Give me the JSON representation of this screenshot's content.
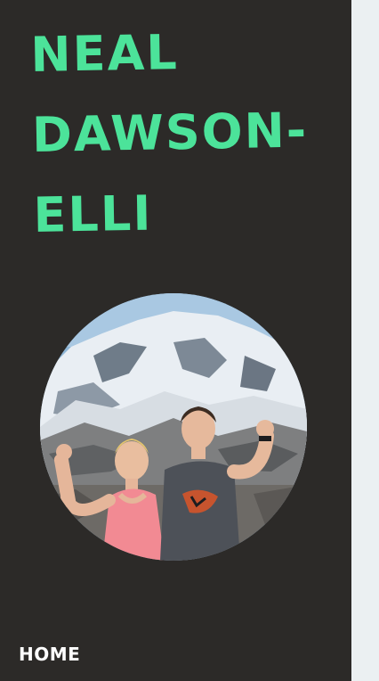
{
  "site": {
    "title_lines": [
      "NEAL",
      "DAWSON-",
      "ELLI"
    ]
  },
  "avatar": {
    "description": "circular profile photo"
  },
  "nav": {
    "items": [
      {
        "label": "HOME"
      }
    ]
  },
  "colors": {
    "sidebar_bg": "#2c2a28",
    "title_green": "#4ce39a",
    "page_bg": "#ebf0f2",
    "nav_text": "#ffffff"
  }
}
